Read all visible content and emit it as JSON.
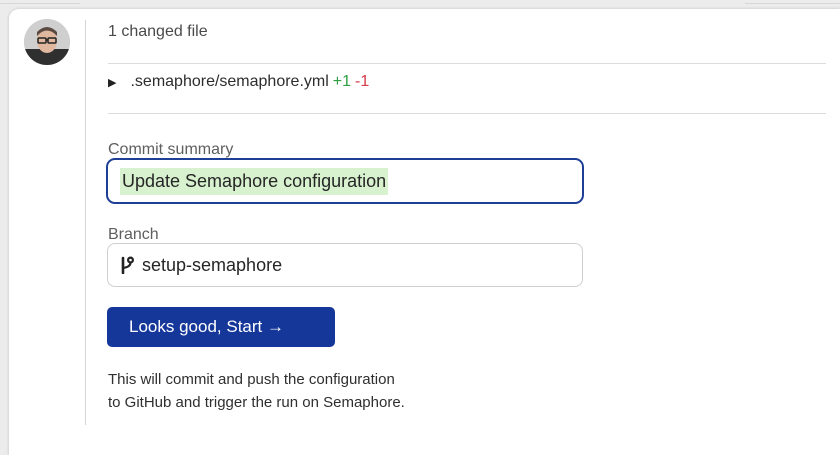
{
  "changes": {
    "title": "1 changed file",
    "file": {
      "path": ".semaphore/semaphore.yml",
      "additions": "+1",
      "deletions": "-1"
    }
  },
  "commit": {
    "label": "Commit summary",
    "value": "Update Semaphore configuration"
  },
  "branch": {
    "label": "Branch",
    "value": "setup-semaphore",
    "icon": "git-branch-icon"
  },
  "start_button": {
    "label": "Looks good, Start →"
  },
  "help_text": {
    "line1": "This will commit and push the configuration",
    "line2": "to GitHub and trigger the run on Semaphore."
  },
  "colors": {
    "primary": "#15379a",
    "focus_border": "#1d3f96",
    "addition": "#2ea043",
    "deletion": "#d73a49",
    "highlight": "#d8f1cf"
  }
}
